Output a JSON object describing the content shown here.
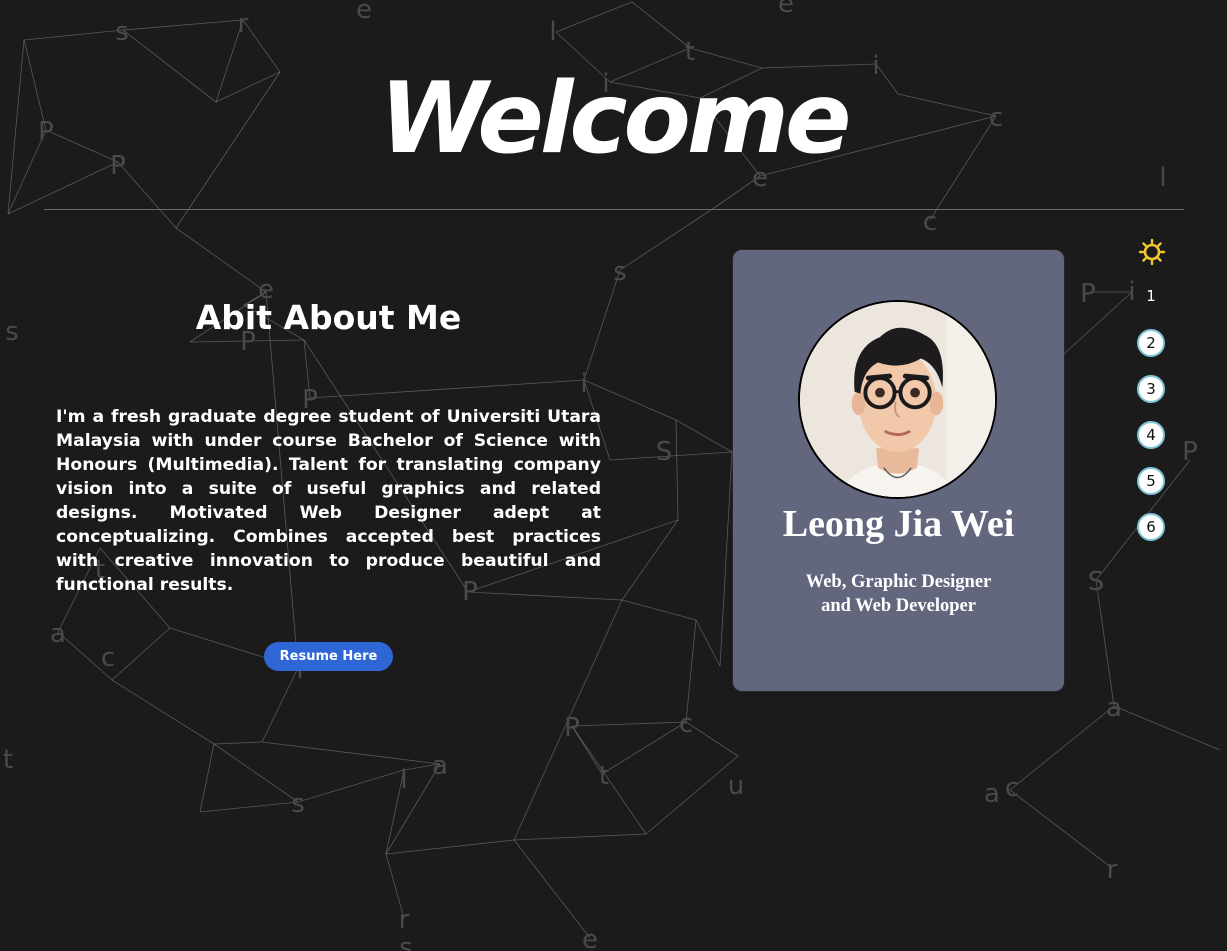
{
  "hero": {
    "title": "Welcome"
  },
  "about": {
    "title": "Abit About Me",
    "body": "I'm a fresh graduate degree student of Universiti Utara Malaysia with under course Bachelor of Science with Honours (Multimedia). Talent for translating company vision into a suite of useful graphics and related designs. Motivated Web Designer adept at conceptualizing. Combines accepted best practices with creative innovation to produce beautiful and functional results.",
    "resume_button": "Resume Here"
  },
  "profile": {
    "name": "Leong Jia Wei",
    "role_line1": "Web, Graphic Designer",
    "role_line2": "and Web Developer"
  },
  "pager": {
    "pages": [
      "1",
      "2",
      "3",
      "4",
      "5",
      "6"
    ],
    "active": "1"
  },
  "colors": {
    "background": "#1b1b1c",
    "card": "#63677e",
    "button": "#2f66d6",
    "pager_ring": "#7fc6d8",
    "sun_icon": "#f2c531"
  },
  "background_letters": [
    "s",
    "r",
    "e",
    "e",
    "l",
    "t",
    "i",
    "i",
    "c",
    "P",
    "P",
    "e",
    "l",
    "c",
    "s",
    "e",
    "i",
    "P",
    "s",
    "P",
    "i",
    "P",
    "S",
    "P",
    "t",
    "P",
    "S",
    "a",
    "i",
    "c",
    "a",
    "P",
    "c",
    "t",
    "l",
    "a",
    "t",
    "u",
    "a",
    "c",
    "s",
    "r",
    "e",
    "r",
    "s"
  ]
}
